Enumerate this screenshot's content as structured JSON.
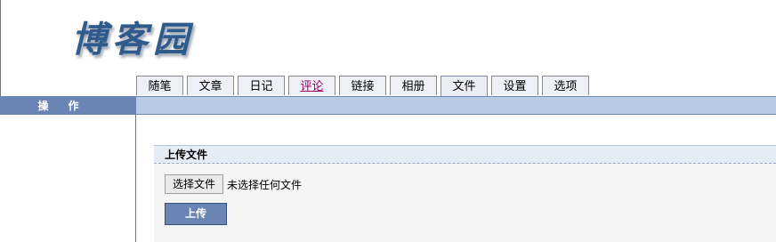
{
  "logo": {
    "text": "博客园"
  },
  "tabs": [
    {
      "label": "随笔"
    },
    {
      "label": "文章"
    },
    {
      "label": "日记"
    },
    {
      "label": "评论"
    },
    {
      "label": "链接"
    },
    {
      "label": "相册"
    },
    {
      "label": "文件"
    },
    {
      "label": "设置"
    },
    {
      "label": "选项"
    }
  ],
  "active_tab": "文件",
  "sidebar": {
    "title": "操作"
  },
  "upload": {
    "section_title": "上传文件",
    "choose_button": "选择文件",
    "no_file_text": "未选择任何文件",
    "submit_button": "上传"
  },
  "colors": {
    "accent": "#6a84b3",
    "bar": "#b8cbe4",
    "logo": "#2f5a8c"
  }
}
